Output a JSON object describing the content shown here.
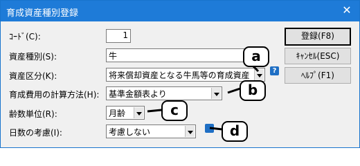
{
  "window": {
    "title": "育成資産種別登録",
    "close_glyph": "✕"
  },
  "form": {
    "code_label": "ｺｰﾄﾞ(C):",
    "code_value": "1",
    "type_label": "資産種別(S):",
    "type_value": "牛",
    "class_label": "資産区分(K):",
    "class_value": "将来償却資産となる牛馬等の育成資産",
    "calc_label": "育成費用の計算方法(H):",
    "calc_value": "基準金額表より",
    "age_unit_label": "齢数単位(R):",
    "age_unit_value": "月齢",
    "days_label": "日数の考慮(I):",
    "days_value": "考慮しない"
  },
  "buttons": {
    "register": "登録(F8)",
    "cancel": "ｷｬﾝｾﾙ(ESC)",
    "help": "ﾍﾙﾌﾟ(F1)"
  },
  "help_icon_glyph": "?",
  "callouts": {
    "a": "a",
    "b": "b",
    "c": "c",
    "d": "d"
  }
}
